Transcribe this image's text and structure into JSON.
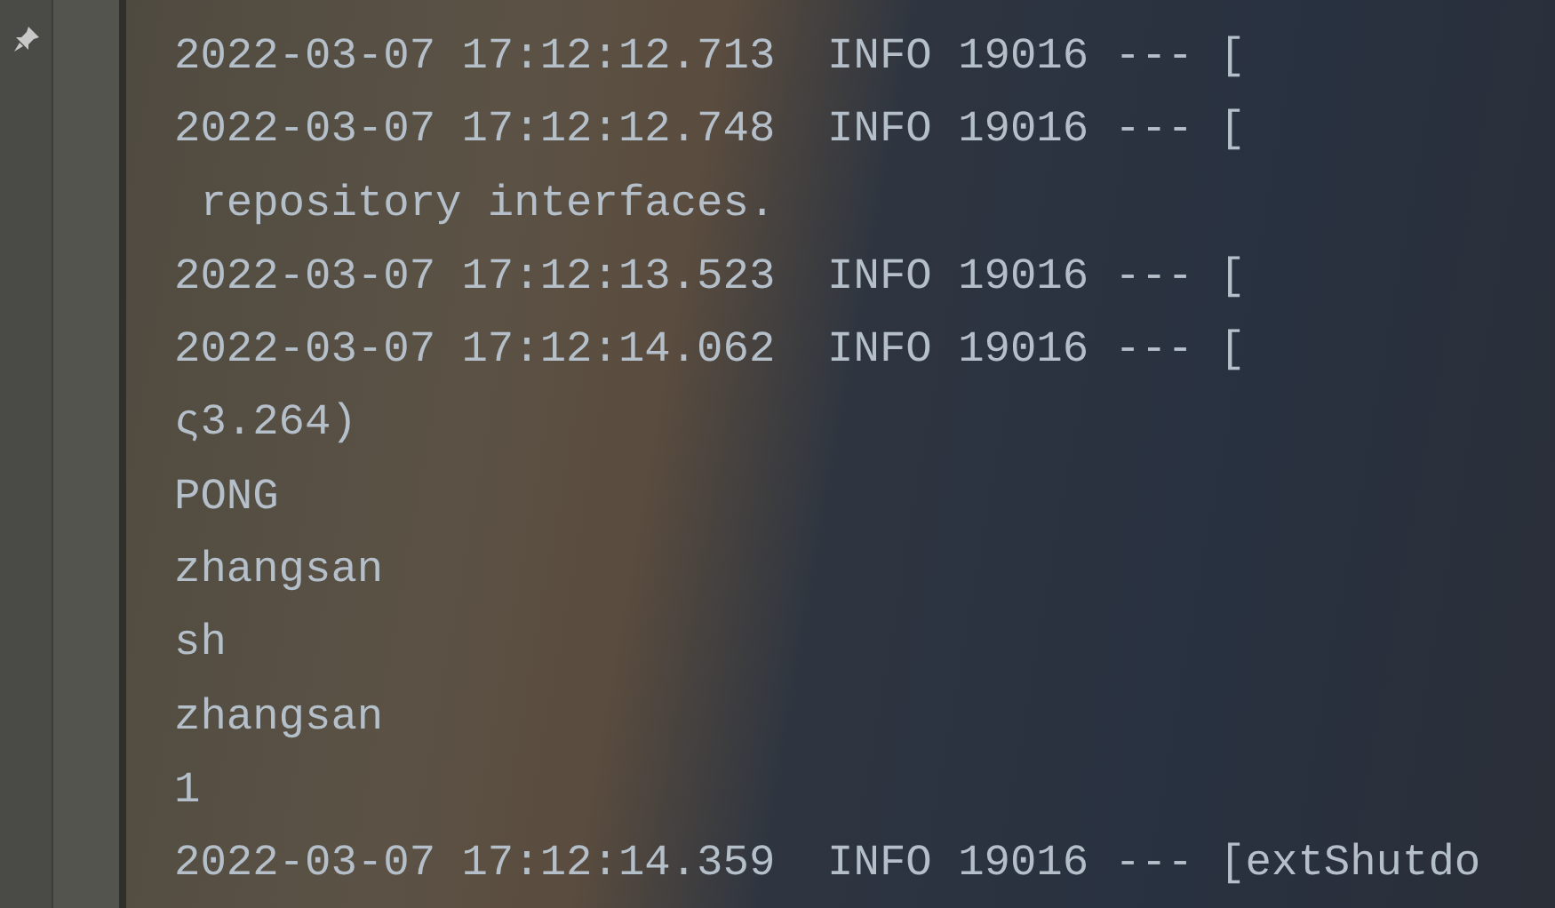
{
  "console": {
    "lines": [
      "2022-03-07 17:12:12.713  INFO 19016 --- [",
      "2022-03-07 17:12:12.748  INFO 19016 --- [",
      " repository interfaces.",
      "2022-03-07 17:12:13.523  INFO 19016 --- [",
      "2022-03-07 17:12:14.062  INFO 19016 --- [",
      "ς3.264)",
      "PONG",
      "zhangsan",
      "sh",
      "zhangsan",
      "1",
      "2022-03-07 17:12:14.359  INFO 19016 --- [extShutdo"
    ]
  }
}
